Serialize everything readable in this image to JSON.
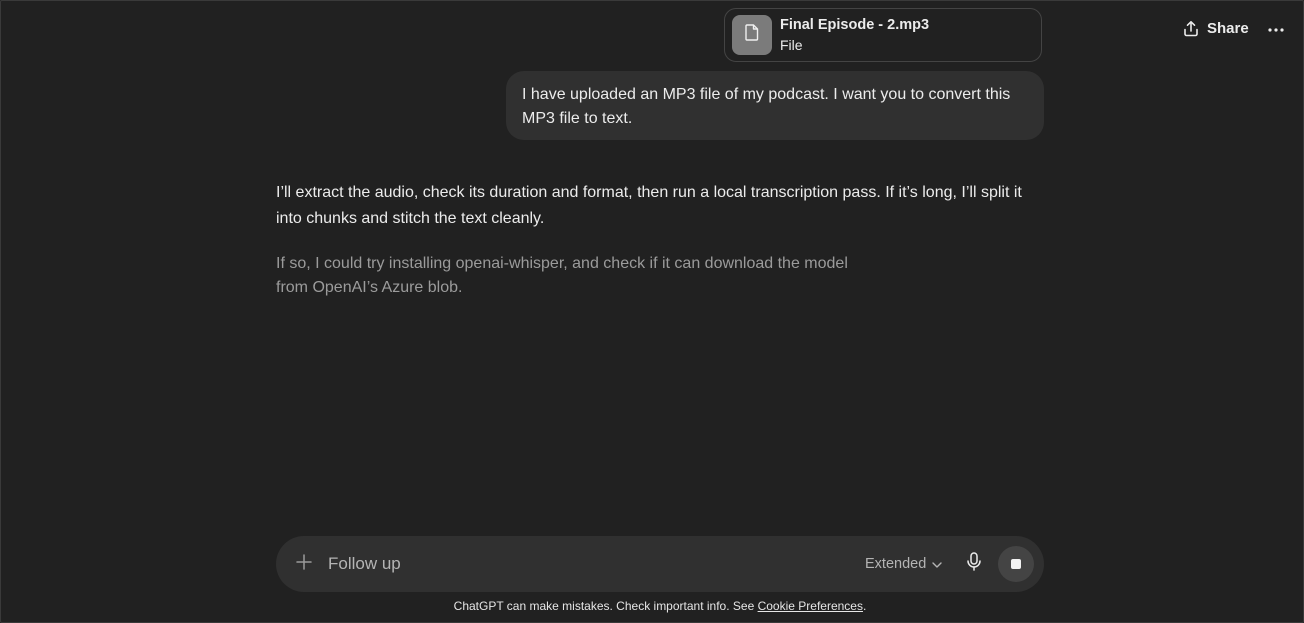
{
  "header": {
    "share_label": "Share",
    "share_icon": "share-icon",
    "more_icon": "more-dots-icon"
  },
  "attachment": {
    "file_name": "Final Episode - 2.mp3",
    "file_type": "File",
    "icon": "document-icon"
  },
  "messages": {
    "user": "I have uploaded an MP3 file of my podcast. I want you to convert this MP3 file to text.",
    "assistant": "I’ll extract the audio, check its duration and format, then run a local transcription pass. If it’s long, I’ll split it into chunks and stitch the text cleanly.",
    "thinking": "If so, I could try installing openai-whisper, and check if it can download the model from OpenAI’s Azure blob."
  },
  "composer": {
    "placeholder": "Follow up",
    "model_label": "Extended",
    "plus_icon": "plus-icon",
    "mic_icon": "microphone-icon",
    "stop_icon": "stop-icon"
  },
  "footer": {
    "disclaimer_text": "ChatGPT can make mistakes. Check important info. See ",
    "link_text": "Cookie Preferences",
    "trailing": "."
  },
  "colors": {
    "background": "#212121",
    "bubble": "#303030",
    "muted_text": "#9b9b9b"
  }
}
